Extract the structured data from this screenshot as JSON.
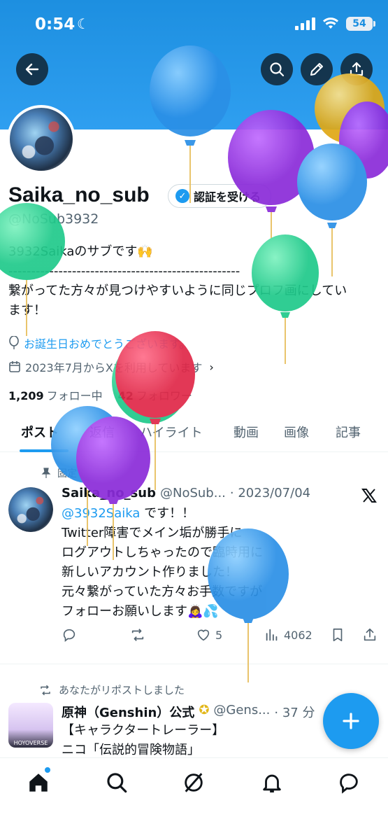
{
  "status": {
    "time": "0:54",
    "battery": "54"
  },
  "profile": {
    "name": "Saika_no_sub",
    "verify_label": "認証を受ける",
    "handle": "@NoSub3932",
    "bio_lines": [
      "3932Saikaのサブです🙌",
      "---------------------------------------------------",
      "繋がってた方々が見つけやすいように同じプロフ画にしてい",
      "ます！"
    ],
    "birthday_text": "お誕生日おめでとうございます。",
    "joined_text": "2023年7月からXを利用しています",
    "following_count": "1,209",
    "following_label": "フォロー中",
    "followers_count": "42",
    "followers_label": "フォロワー"
  },
  "tabs": [
    "ポスト",
    "返信",
    "ハイライト",
    "動画",
    "画像",
    "記事"
  ],
  "pinned_post": {
    "pinned_label": "固定",
    "author": "Saika_no_sub",
    "handle": "@NoSub...",
    "date": "· 2023/07/04",
    "mention": "@3932Saika",
    "body_first": " です！！",
    "body_lines": [
      "Twitter障害でメイン垢が勝手に",
      "ログアウトしちゃったので臨時用に",
      "新しいアカウント作りました！",
      "元々繋がっていた方々お手数ですが",
      "フォローお願いします🙇‍♀️💦"
    ],
    "likes": "5",
    "views": "4062"
  },
  "repost": {
    "label": "あなたがリポストしました",
    "author": "原神（Genshin）公式",
    "handle": "@Gens...",
    "time": "· 37 分",
    "line1": "【キャラクタートレーラー】",
    "line2": "ニコ「伝説的冒険物語」",
    "avatar_text": "HOYOVERSE"
  }
}
